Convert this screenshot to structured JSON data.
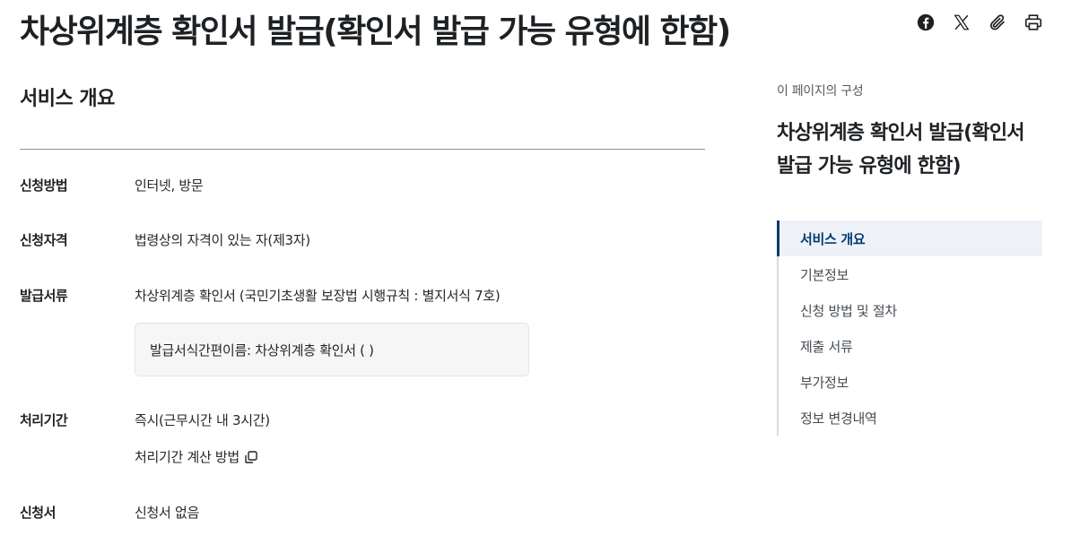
{
  "page": {
    "title": "차상위계층 확인서 발급(확인서 발급 가능 유형에 한함)"
  },
  "share_tools": [
    {
      "icon": "facebook-icon",
      "label": "facebook"
    },
    {
      "icon": "x-icon",
      "label": "X"
    },
    {
      "icon": "paperclip-icon",
      "label": "copy link"
    },
    {
      "icon": "print-icon",
      "label": "print"
    }
  ],
  "overview": {
    "heading": "서비스 개요",
    "rows": [
      {
        "label": "신청방법",
        "value": "인터넷, 방문"
      },
      {
        "label": "신청자격",
        "value": "법령상의 자격이 있는 자(제3자)"
      },
      {
        "label": "발급서류",
        "value": "차상위계층 확인서 (국민기초생활 보장법 시행규칙 : 별지서식 7호)"
      },
      {
        "label": "처리기간",
        "value": "즉시(근무시간 내 3시간)"
      },
      {
        "label": "신청서",
        "value": "신청서 없음"
      }
    ],
    "doc_box": "발급서식간편이름: 차상위계층 확인서 ( )",
    "calc_link": "처리기간 계산 방법"
  },
  "toc": {
    "caption": "이 페이지의 구성",
    "title": "차상위계층 확인서 발급(확인서 발급 가능 유형에 한함)",
    "items": [
      {
        "label": "서비스 개요",
        "active": true
      },
      {
        "label": "기본정보"
      },
      {
        "label": "신청 방법 및 절차"
      },
      {
        "label": "제출 서류"
      },
      {
        "label": "부가정보"
      },
      {
        "label": "정보 변경내역"
      }
    ]
  },
  "colors": {
    "text": "#1e2124",
    "accent": "#063a74",
    "active_bg": "#eef2f7",
    "box_bg": "#f6f6f7"
  }
}
